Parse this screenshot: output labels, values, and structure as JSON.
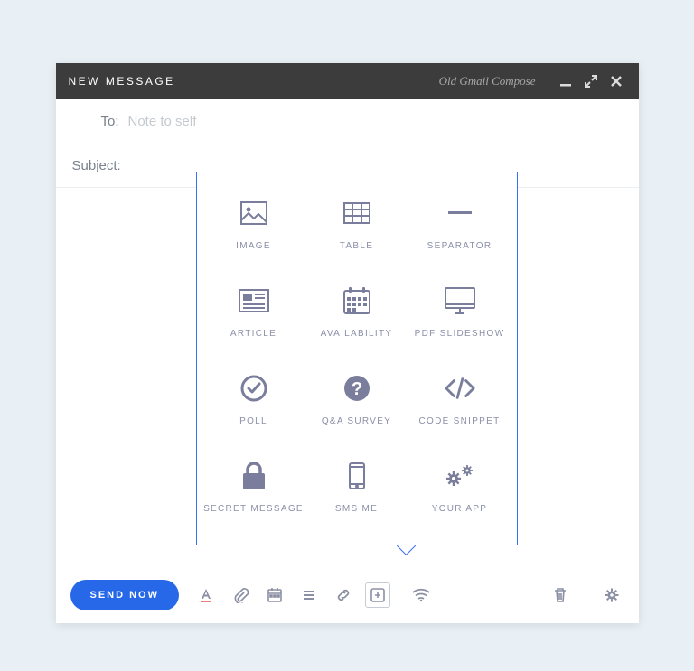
{
  "window": {
    "title": "NEW MESSAGE",
    "old_compose_link": "Old Gmail Compose"
  },
  "to": {
    "label": "To:",
    "placeholder": "Note to self"
  },
  "subject": {
    "label": "Subject:"
  },
  "popover": {
    "items": [
      {
        "name": "image-tile",
        "label": "IMAGE",
        "icon": "image-icon"
      },
      {
        "name": "table-tile",
        "label": "TABLE",
        "icon": "table-icon"
      },
      {
        "name": "separator-tile",
        "label": "SEPARATOR",
        "icon": "separator-icon"
      },
      {
        "name": "article-tile",
        "label": "ARTICLE",
        "icon": "article-icon"
      },
      {
        "name": "availability-tile",
        "label": "AVAILABILITY",
        "icon": "calendar-grid-icon"
      },
      {
        "name": "pdf-slideshow-tile",
        "label": "PDF SLIDESHOW",
        "icon": "monitor-icon"
      },
      {
        "name": "poll-tile",
        "label": "POLL",
        "icon": "check-circle-icon"
      },
      {
        "name": "qa-survey-tile",
        "label": "Q&A SURVEY",
        "icon": "question-circle-icon"
      },
      {
        "name": "code-snippet-tile",
        "label": "CODE SNIPPET",
        "icon": "code-icon"
      },
      {
        "name": "secret-message-tile",
        "label": "SECRET MESSAGE",
        "icon": "lock-icon"
      },
      {
        "name": "sms-me-tile",
        "label": "SMS ME",
        "icon": "phone-icon"
      },
      {
        "name": "your-app-tile",
        "label": "YOUR APP",
        "icon": "gears-icon"
      }
    ]
  },
  "toolbar": {
    "send_label": "SEND NOW"
  },
  "colors": {
    "accent": "#2668e8",
    "popover_border": "#3a6ff2",
    "icon": "#7a7e9c"
  }
}
